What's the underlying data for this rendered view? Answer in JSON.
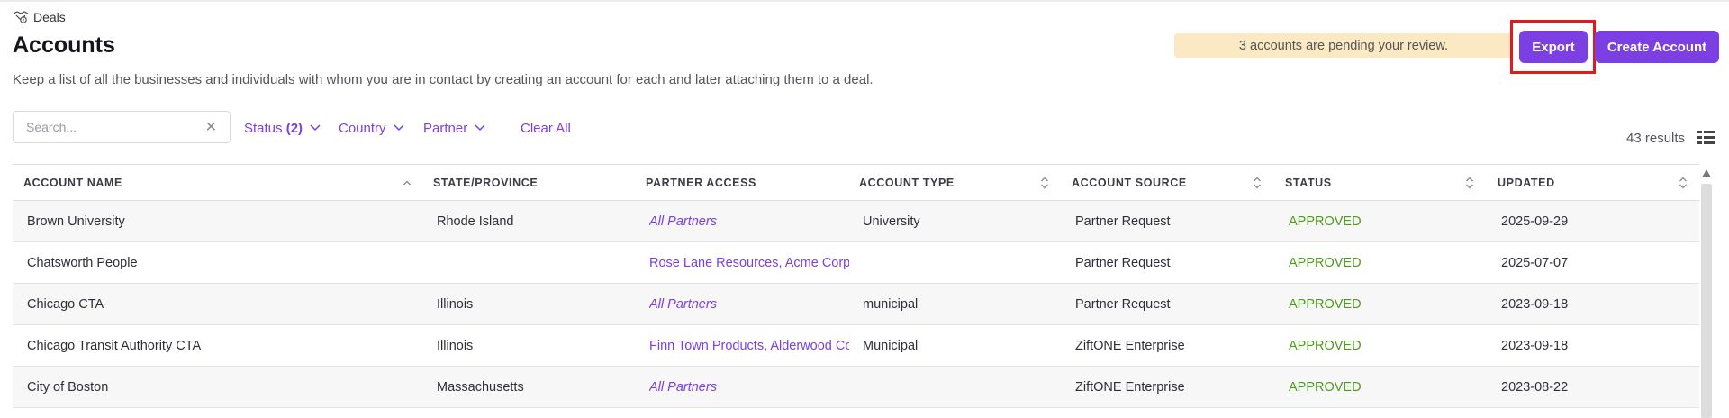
{
  "breadcrumb": {
    "icon": "handshake-icon",
    "label": "Deals"
  },
  "header": {
    "title": "Accounts",
    "description": "Keep a list of all the businesses and individuals with whom you are in contact by creating an account for each and later attaching them to a deal.",
    "pending_banner": "3 accounts are pending your review.",
    "export_label": "Export",
    "create_label": "Create Account"
  },
  "filters": {
    "search_placeholder": "Search...",
    "status_label": "Status",
    "status_count": "(2)",
    "country_label": "Country",
    "partner_label": "Partner",
    "clear_all_label": "Clear All"
  },
  "results": {
    "count_text": "43 results"
  },
  "table": {
    "columns": [
      "ACCOUNT NAME",
      "STATE/PROVINCE",
      "PARTNER ACCESS",
      "ACCOUNT TYPE",
      "ACCOUNT SOURCE",
      "STATUS",
      "UPDATED"
    ],
    "rows": [
      {
        "name": "Brown University",
        "state": "Rhode Island",
        "partner": "All Partners",
        "partner_all": true,
        "type": "University",
        "source": "Partner Request",
        "status": "APPROVED",
        "updated": "2025-09-29"
      },
      {
        "name": "Chatsworth People",
        "state": "",
        "partner": "Rose Lane Resources, Acme Corp",
        "partner_all": false,
        "type": "",
        "source": "Partner Request",
        "status": "APPROVED",
        "updated": "2025-07-07"
      },
      {
        "name": "Chicago CTA",
        "state": "Illinois",
        "partner": "All Partners",
        "partner_all": true,
        "type": "municipal",
        "source": "Partner Request",
        "status": "APPROVED",
        "updated": "2023-09-18"
      },
      {
        "name": "Chicago Transit Authority CTA",
        "state": "Illinois",
        "partner": "Finn Town Products, Alderwood Co",
        "partner_all": false,
        "type": "Municipal",
        "source": "ZiftONE Enterprise",
        "status": "APPROVED",
        "updated": "2023-09-18"
      },
      {
        "name": "City of Boston",
        "state": "Massachusetts",
        "partner": "All Partners",
        "partner_all": true,
        "type": "",
        "source": "ZiftONE Enterprise",
        "status": "APPROVED",
        "updated": "2023-08-22"
      }
    ]
  },
  "colors": {
    "accent": "#7b3fe4",
    "status_approved": "#4f9a1a",
    "banner_bg": "#fbe9c3",
    "highlight": "#e01b1b"
  }
}
